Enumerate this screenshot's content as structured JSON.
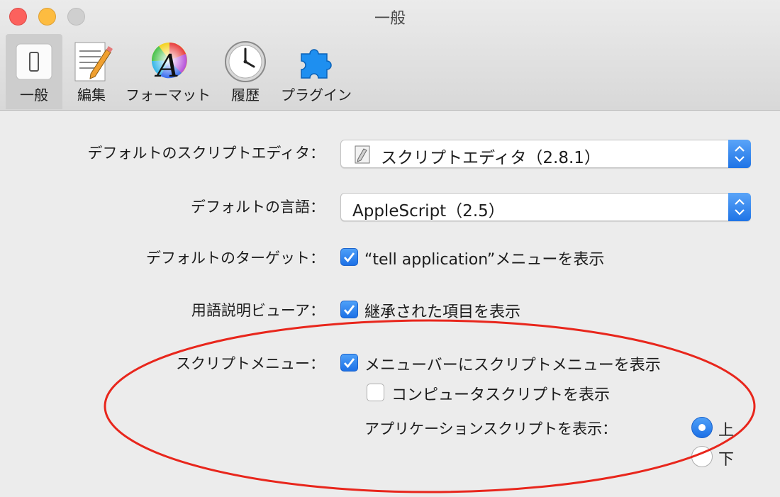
{
  "window": {
    "title": "一般"
  },
  "toolbar": {
    "items": [
      {
        "label": "一般",
        "icon": "general-switch-icon",
        "selected": true
      },
      {
        "label": "編集",
        "icon": "notepad-pencil-icon",
        "selected": false
      },
      {
        "label": "フォーマット",
        "icon": "font-color-wheel-icon",
        "selected": false
      },
      {
        "label": "履歴",
        "icon": "clock-icon",
        "selected": false
      },
      {
        "label": "プラグイン",
        "icon": "puzzle-piece-icon",
        "selected": false
      }
    ]
  },
  "settings": {
    "default_editor": {
      "label": "デフォルトのスクリプトエディタ：",
      "value": "スクリプトエディタ（2.8.1）"
    },
    "default_language": {
      "label": "デフォルトの言語：",
      "value": "AppleScript（2.5）"
    },
    "default_target": {
      "label": "デフォルトのターゲット：",
      "checkbox_label": "“tell application”メニューを表示",
      "checked": true
    },
    "dictionary_viewer": {
      "label": "用語説明ビューア：",
      "checkbox_label": "継承された項目を表示",
      "checked": true
    },
    "script_menu": {
      "label": "スクリプトメニュー：",
      "show_in_menubar": {
        "label": "メニューバーにスクリプトメニューを表示",
        "checked": true
      },
      "show_computer_scripts": {
        "label": "コンピュータスクリプトを表示",
        "checked": false
      },
      "app_scripts_position": {
        "label": "アプリケーションスクリプトを表示：",
        "options": [
          {
            "label": "上",
            "selected": true
          },
          {
            "label": "下",
            "selected": false
          }
        ]
      }
    }
  },
  "colors": {
    "accent": "#1f74e6",
    "annotation": "#e8261c"
  }
}
